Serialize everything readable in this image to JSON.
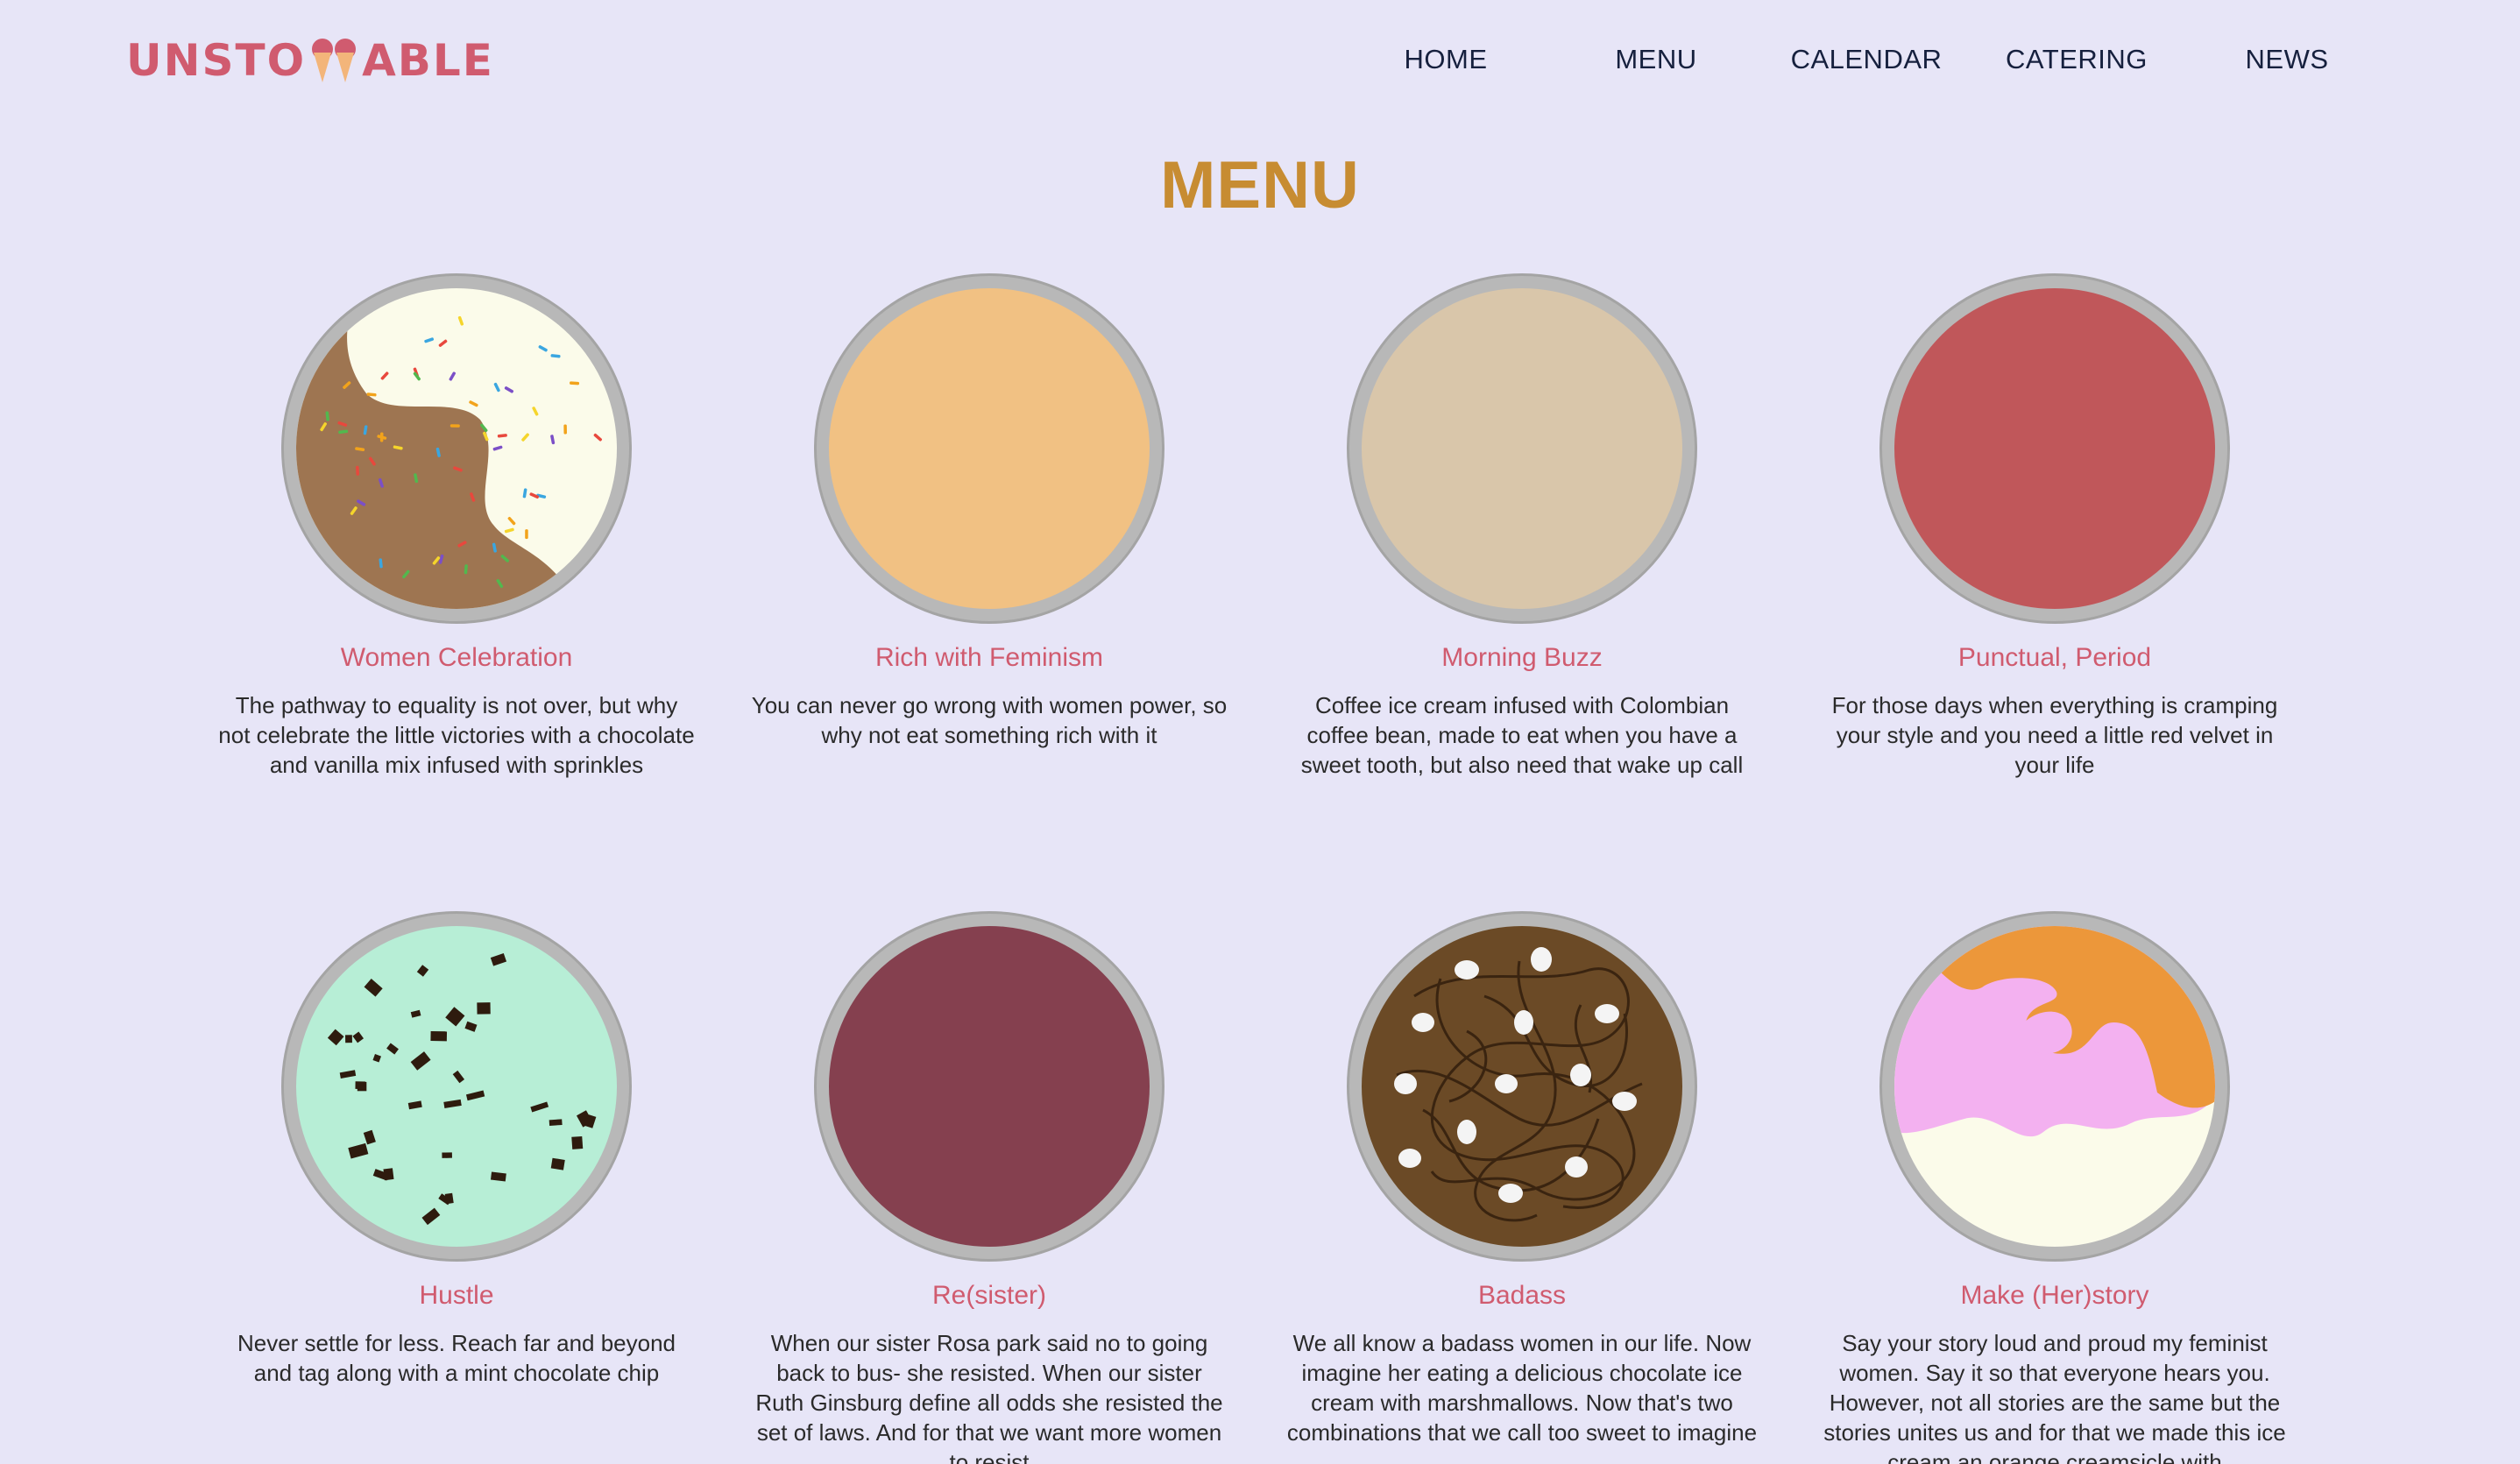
{
  "header": {
    "logo_left": "UNSTO",
    "logo_right": "ABLE",
    "nav": [
      "HOME",
      "MENU",
      "CALENDAR",
      "CATERING",
      "NEWS"
    ]
  },
  "page_title": "MENU",
  "colors": {
    "background": "#e7e5f7",
    "accent_pink": "#d05b6f",
    "title_gold": "#c78c32",
    "nav_text": "#16203e"
  },
  "items": [
    {
      "name": "Women Celebration",
      "desc": "The pathway to equality is not over, but why not celebrate the little victories with a chocolate and vanilla mix infused with sprinkles",
      "flavor": "chocolate-vanilla-sprinkles"
    },
    {
      "name": "Rich with Feminism",
      "desc": "You can never go wrong with women power, so why not eat something rich with it",
      "flavor": "peach",
      "color": "#f1c183"
    },
    {
      "name": "Morning Buzz",
      "desc": "Coffee ice cream infused with Colombian coffee bean, made to eat when you have a sweet tooth, but also need that wake up call",
      "flavor": "coffee",
      "color": "#d9c6aa"
    },
    {
      "name": "Punctual, Period",
      "desc": "For those days when everything is cramping your style and you need a little red velvet in your life",
      "flavor": "red-velvet",
      "color": "#c0575a"
    },
    {
      "name": "Hustle",
      "desc": "Never settle for less. Reach far and beyond and tag along with a mint chocolate chip",
      "flavor": "mint-chocolate-chip"
    },
    {
      "name": "Re(sister)",
      "desc": "When our sister Rosa park said no to going back to bus- she resisted. When our sister Ruth Ginsburg define all odds she resisted the set of laws. And for that we want more women to resist",
      "flavor": "berry",
      "color": "#85404f"
    },
    {
      "name": "Badass",
      "desc": "We all know a badass women in our life. Now imagine her eating a delicious chocolate ice cream with marshmallows. Now that's two combinations that we call too sweet to imagine",
      "flavor": "chocolate-marshmallow"
    },
    {
      "name": "Make (Her)story",
      "desc": "Say your story loud and proud my feminist women. Say it so that everyone hears you. However, not all stories are the same but the stories unites us and for that we made this ice cream an orange creamsicle with",
      "flavor": "orange-creamsicle"
    }
  ]
}
